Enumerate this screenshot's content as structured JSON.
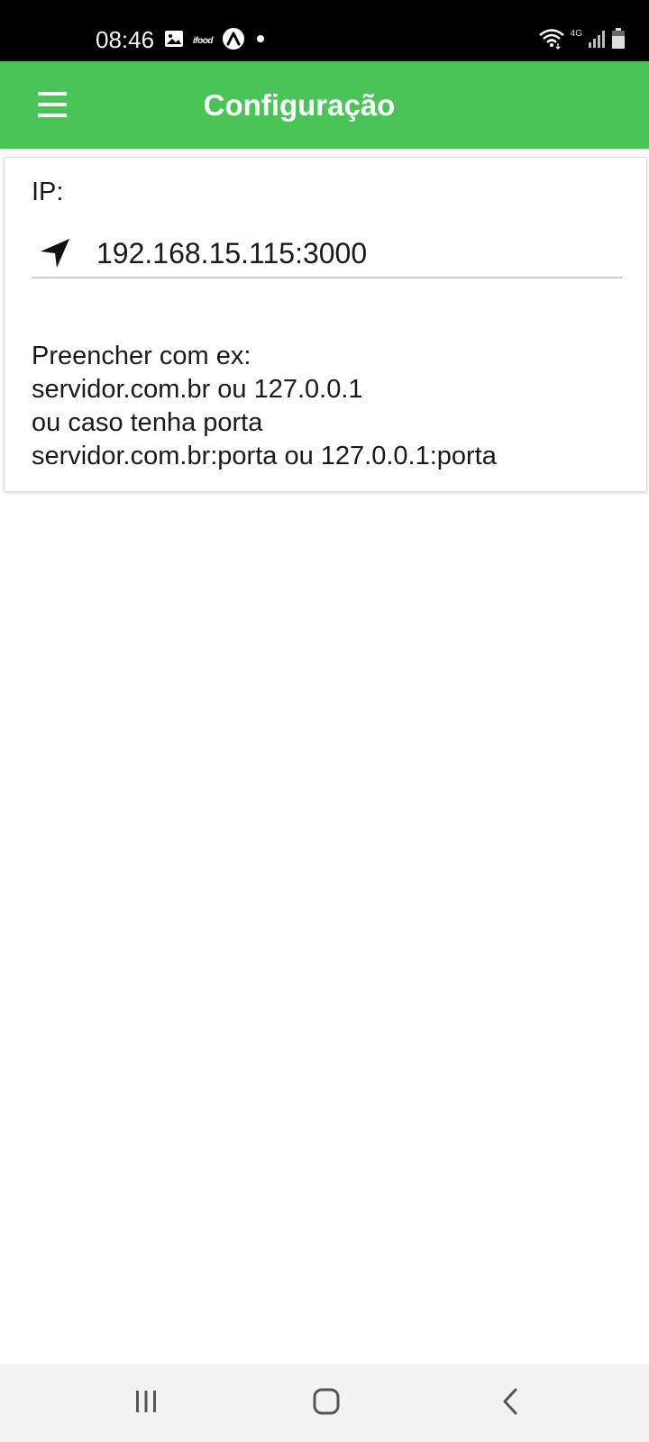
{
  "status_bar": {
    "time": "08:46",
    "left_icons": [
      "gallery-icon",
      "ifood-icon",
      "app-a-icon",
      "dot-icon"
    ],
    "ifood_text": "ifood",
    "network_label": "4G",
    "right_icons": [
      "wifi-icon",
      "signal-icon",
      "battery-icon"
    ]
  },
  "app_bar": {
    "title": "Configuração",
    "menu_icon": "menu-icon",
    "background_color": "#4ac358"
  },
  "form": {
    "ip_label": "IP:",
    "ip_icon": "navigation-arrow-icon",
    "ip_value": "192.168.15.115:3000",
    "help_lines": [
      "Preencher com ex:",
      "servidor.com.br ou 127.0.0.1",
      "ou caso tenha porta",
      "servidor.com.br:porta ou 127.0.0.1:porta"
    ]
  },
  "nav_bar": {
    "buttons": [
      "recents-icon",
      "home-icon",
      "back-icon"
    ]
  }
}
